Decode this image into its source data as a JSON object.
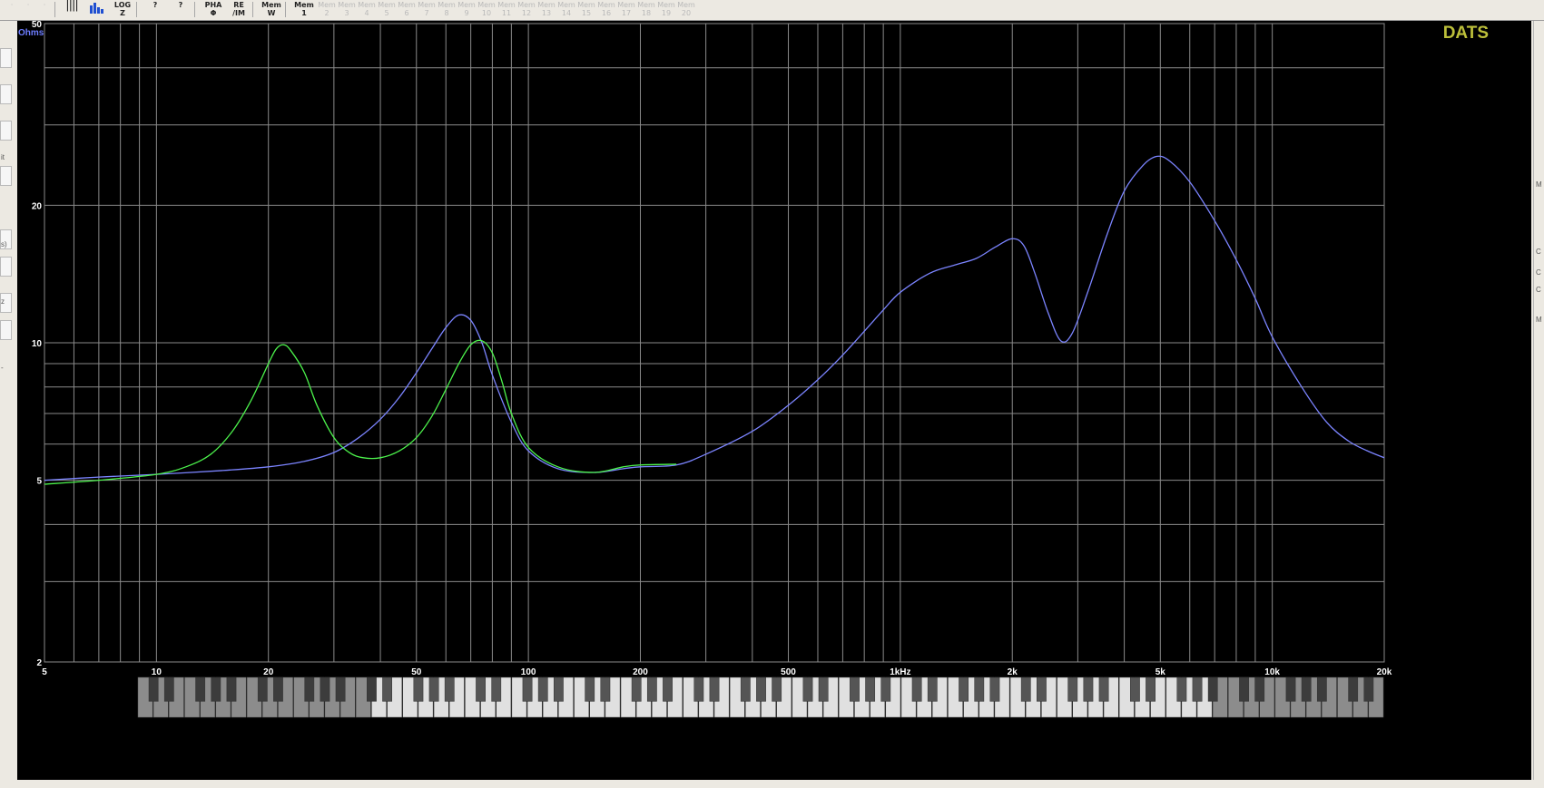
{
  "toolbar": {
    "items": [
      {
        "icon": "freq-lines-icon",
        "label": "",
        "dim": false
      },
      {
        "icon": "histogram-icon",
        "label": "",
        "dim": false
      },
      {
        "icon": "log-z-icon",
        "label": "LOG Z",
        "dim": false
      },
      {
        "icon": "help-icon",
        "label": "?",
        "dim": false
      },
      {
        "icon": "context-help-icon",
        "label": "?",
        "dim": false
      },
      {
        "icon": "phase-icon",
        "label": "PHA Φ",
        "dim": false
      },
      {
        "icon": "re-im-icon",
        "label": "RE /IM",
        "dim": false
      },
      {
        "icon": "mem-write-icon",
        "label": "Mem W",
        "dim": false
      },
      {
        "icon": "mem-1-icon",
        "label": "Mem 1",
        "dim": false
      }
    ],
    "mem_slots": [
      "2",
      "3",
      "4",
      "5",
      "6",
      "7",
      "8",
      "9",
      "10",
      "11",
      "12",
      "13",
      "14",
      "15",
      "16",
      "17",
      "18",
      "19",
      "20"
    ]
  },
  "left_panel_chars": [
    "it",
    "s)",
    "z",
    "-"
  ],
  "right_panel_chars": [
    "M",
    "C",
    "C",
    "C",
    "M"
  ],
  "colors": {
    "background": "#000000",
    "grid": "#8a8a8a",
    "axis_text": "#ffffff",
    "ohms_label": "#6d7dff",
    "logo": "#bcbf3a",
    "series_blue": "#7b84ff",
    "series_green": "#4cf24c"
  },
  "chart_data": {
    "type": "line",
    "title": "",
    "logo_text": "DATS",
    "ylabel": "Ohms",
    "xlabel": "",
    "x_scale": "log",
    "y_scale": "log",
    "xlim": [
      5,
      20000
    ],
    "ylim": [
      2,
      50
    ],
    "grid": true,
    "x_ticks": [
      {
        "value": 5,
        "label": "5"
      },
      {
        "value": 10,
        "label": "10"
      },
      {
        "value": 20,
        "label": "20"
      },
      {
        "value": 50,
        "label": "50"
      },
      {
        "value": 100,
        "label": "100"
      },
      {
        "value": 200,
        "label": "200"
      },
      {
        "value": 500,
        "label": "500"
      },
      {
        "value": 1000,
        "label": "1kHz"
      },
      {
        "value": 2000,
        "label": "2k"
      },
      {
        "value": 5000,
        "label": "5k"
      },
      {
        "value": 10000,
        "label": "10k"
      },
      {
        "value": 20000,
        "label": "20k"
      }
    ],
    "y_ticks": [
      {
        "value": 2,
        "label": "2"
      },
      {
        "value": 5,
        "label": "5"
      },
      {
        "value": 10,
        "label": "10"
      },
      {
        "value": 20,
        "label": "20"
      },
      {
        "value": 50,
        "label": "50"
      }
    ],
    "series": [
      {
        "color": "#7b84ff",
        "points": [
          [
            5,
            5.0
          ],
          [
            7,
            5.08
          ],
          [
            10,
            5.15
          ],
          [
            15,
            5.25
          ],
          [
            20,
            5.35
          ],
          [
            25,
            5.5
          ],
          [
            30,
            5.75
          ],
          [
            35,
            6.2
          ],
          [
            40,
            6.8
          ],
          [
            45,
            7.6
          ],
          [
            50,
            8.6
          ],
          [
            55,
            9.7
          ],
          [
            60,
            10.8
          ],
          [
            65,
            11.5
          ],
          [
            70,
            11.2
          ],
          [
            75,
            10.0
          ],
          [
            80,
            8.5
          ],
          [
            90,
            6.7
          ],
          [
            100,
            5.8
          ],
          [
            120,
            5.3
          ],
          [
            150,
            5.2
          ],
          [
            180,
            5.3
          ],
          [
            200,
            5.35
          ],
          [
            250,
            5.4
          ],
          [
            300,
            5.7
          ],
          [
            400,
            6.4
          ],
          [
            500,
            7.3
          ],
          [
            600,
            8.3
          ],
          [
            700,
            9.4
          ],
          [
            800,
            10.6
          ],
          [
            900,
            11.8
          ],
          [
            1000,
            12.9
          ],
          [
            1200,
            14.2
          ],
          [
            1400,
            14.8
          ],
          [
            1600,
            15.3
          ],
          [
            1800,
            16.2
          ],
          [
            2000,
            16.9
          ],
          [
            2150,
            16.3
          ],
          [
            2300,
            14.2
          ],
          [
            2500,
            11.6
          ],
          [
            2700,
            10.1
          ],
          [
            2900,
            10.5
          ],
          [
            3200,
            13.0
          ],
          [
            3600,
            17.3
          ],
          [
            4000,
            21.5
          ],
          [
            4500,
            24.5
          ],
          [
            4900,
            25.6
          ],
          [
            5300,
            25.0
          ],
          [
            6000,
            22.5
          ],
          [
            7000,
            18.5
          ],
          [
            8000,
            15.2
          ],
          [
            9000,
            12.5
          ],
          [
            10000,
            10.3
          ],
          [
            12000,
            8.0
          ],
          [
            14000,
            6.7
          ],
          [
            16000,
            6.1
          ],
          [
            18000,
            5.8
          ],
          [
            20000,
            5.6
          ]
        ]
      },
      {
        "color": "#4cf24c",
        "points": [
          [
            5,
            4.9
          ],
          [
            7,
            5.0
          ],
          [
            10,
            5.15
          ],
          [
            12,
            5.35
          ],
          [
            14,
            5.7
          ],
          [
            16,
            6.4
          ],
          [
            18,
            7.5
          ],
          [
            20,
            9.0
          ],
          [
            21,
            9.7
          ],
          [
            22,
            9.9
          ],
          [
            23,
            9.6
          ],
          [
            25,
            8.6
          ],
          [
            27,
            7.3
          ],
          [
            30,
            6.2
          ],
          [
            33,
            5.75
          ],
          [
            36,
            5.6
          ],
          [
            40,
            5.6
          ],
          [
            45,
            5.8
          ],
          [
            50,
            6.2
          ],
          [
            55,
            6.9
          ],
          [
            60,
            7.9
          ],
          [
            65,
            9.0
          ],
          [
            70,
            9.9
          ],
          [
            75,
            10.1
          ],
          [
            80,
            9.5
          ],
          [
            85,
            8.2
          ],
          [
            90,
            7.0
          ],
          [
            100,
            5.9
          ],
          [
            120,
            5.35
          ],
          [
            150,
            5.2
          ],
          [
            180,
            5.35
          ],
          [
            200,
            5.4
          ],
          [
            250,
            5.42
          ]
        ]
      }
    ]
  }
}
